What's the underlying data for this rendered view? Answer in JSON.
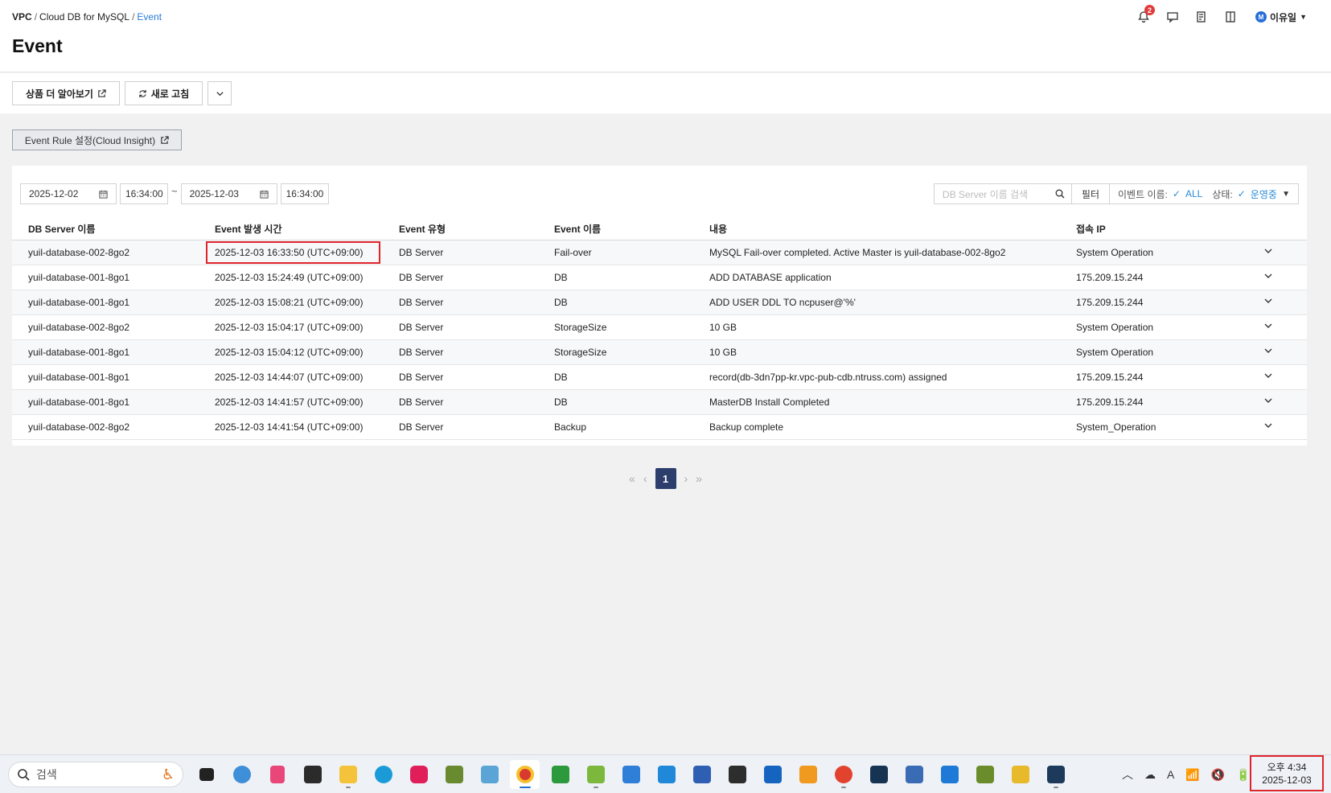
{
  "breadcrumb": {
    "root": "VPC",
    "middle": "Cloud DB for MySQL",
    "current": "Event"
  },
  "page": {
    "title": "Event"
  },
  "header": {
    "notification_count": "2",
    "user_initial": "M",
    "user_name": "이유일"
  },
  "toolbar": {
    "learn_more": "상품 더 알아보기",
    "refresh": "새로 고침"
  },
  "rule_button": "Event Rule 설정(Cloud Insight)",
  "filters": {
    "start_date": "2025-12-02",
    "start_time": "16:34:00",
    "range_sep": "~",
    "end_date": "2025-12-03",
    "end_time": "16:34:00",
    "search_placeholder": "DB Server 이름 검색",
    "filter_label": "필터",
    "event_name_label": "이벤트 이름:",
    "event_name_value": "ALL",
    "status_label": "상태:",
    "status_value": "운영중"
  },
  "table": {
    "headers": [
      "DB Server 이름",
      "Event 발생 시간",
      "Event 유형",
      "Event 이름",
      "내용",
      "접속 IP"
    ],
    "rows": [
      [
        "yuil-database-002-8go2",
        "2025-12-03 16:33:50 (UTC+09:00)",
        "DB Server",
        "Fail-over",
        "MySQL Fail-over completed. Active Master is yuil-database-002-8go2",
        "System Operation"
      ],
      [
        "yuil-database-001-8go1",
        "2025-12-03 15:24:49 (UTC+09:00)",
        "DB Server",
        "DB",
        "ADD DATABASE application",
        "175.209.15.244"
      ],
      [
        "yuil-database-001-8go1",
        "2025-12-03 15:08:21 (UTC+09:00)",
        "DB Server",
        "DB",
        "ADD USER DDL TO ncpuser@'%'",
        "175.209.15.244"
      ],
      [
        "yuil-database-002-8go2",
        "2025-12-03 15:04:17 (UTC+09:00)",
        "DB Server",
        "StorageSize",
        "10 GB",
        "System Operation"
      ],
      [
        "yuil-database-001-8go1",
        "2025-12-03 15:04:12 (UTC+09:00)",
        "DB Server",
        "StorageSize",
        "10 GB",
        "System Operation"
      ],
      [
        "yuil-database-001-8go1",
        "2025-12-03 14:44:07 (UTC+09:00)",
        "DB Server",
        "DB",
        "record(db-3dn7pp-kr.vpc-pub-cdb.ntruss.com) assigned",
        "175.209.15.244"
      ],
      [
        "yuil-database-001-8go1",
        "2025-12-03 14:41:57 (UTC+09:00)",
        "DB Server",
        "DB",
        "MasterDB Install Completed",
        "175.209.15.244"
      ],
      [
        "yuil-database-002-8go2",
        "2025-12-03 14:41:54 (UTC+09:00)",
        "DB Server",
        "Backup",
        "Backup complete",
        "System_Operation"
      ]
    ]
  },
  "pagination": {
    "current_page": "1"
  },
  "taskbar": {
    "search_placeholder": "검색",
    "apps": [
      "accessibility",
      "terminal-window",
      "maps",
      "snipping-tool",
      "sticky-notes",
      "file-explorer",
      "edge",
      "slack",
      "paint",
      "photos",
      "chrome",
      "visibility-tool",
      "notepad-plus",
      "notepad",
      "vscode",
      "powershell",
      "terminal",
      "wireshark",
      "virtualbox",
      "browser-red",
      "vpn",
      "network-tool",
      "remote-desktop",
      "network-admin",
      "figma",
      "mysql-workbench"
    ],
    "tray_icons": [
      "chevron-up-icon",
      "cloud-icon",
      "font-icon",
      "wifi-icon",
      "volume-icon",
      "battery-icon"
    ],
    "clock_time": "오후 4:34",
    "clock_date": "2025-12-03"
  },
  "colors": {
    "accent": "#2a7bd8",
    "highlight": "#e0242c",
    "pager_active": "#2c3e6b"
  }
}
